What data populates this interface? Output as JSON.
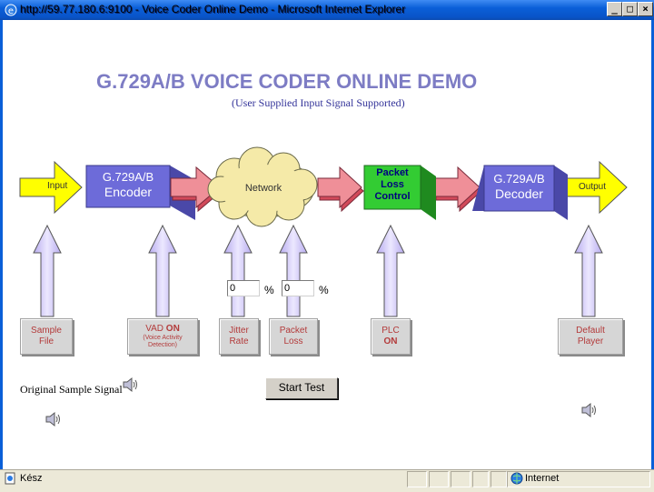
{
  "window": {
    "title": "http://59.77.180.6:9100 - Voice Coder Online Demo - Microsoft Internet Explorer",
    "minimize": "_",
    "maximize": "□",
    "close": "×"
  },
  "page": {
    "heading": "G.729A/B VOICE CODER ONLINE DEMO",
    "subheading": "(User Supplied Input Signal Supported)"
  },
  "diagram": {
    "input_label": "Input",
    "encoder_line1": "G.729A/B",
    "encoder_line2": "Encoder",
    "network_label": "Network",
    "plc_line1": "Packet",
    "plc_line2": "Loss",
    "plc_line3": "Control",
    "decoder_line1": "G.729A/B",
    "decoder_line2": "Decoder",
    "output_label": "Output"
  },
  "controls": {
    "jitter_value": "0",
    "loss_value": "0",
    "percent_symbol": "%",
    "sample_file": {
      "line1": "Sample",
      "line2": "File"
    },
    "vad": {
      "line1a": "VAD ",
      "line1b": "ON",
      "line2": "(Voice Activity",
      "line3": "Detection)"
    },
    "jitter": {
      "line1": "Jitter",
      "line2": "Rate"
    },
    "packet_loss": {
      "line1": "Packet",
      "line2": "Loss"
    },
    "plc": {
      "line1": "PLC",
      "line2": "ON"
    },
    "player": {
      "line1": "Default",
      "line2": "Player"
    },
    "start_button": "Start Test",
    "original_label": "Original Sample Signal"
  },
  "statusbar": {
    "status": "Kész",
    "zone": "Internet"
  },
  "colors": {
    "heading": "#7d7cc4",
    "arrow_yellow": "#ffff00",
    "block_purple": "#6d6bd9",
    "cloud": "#f5eaa8",
    "plc_green": "#33cc33",
    "pink_arrow": "#ef8f98",
    "up_arrow": "#d9d0f5"
  }
}
